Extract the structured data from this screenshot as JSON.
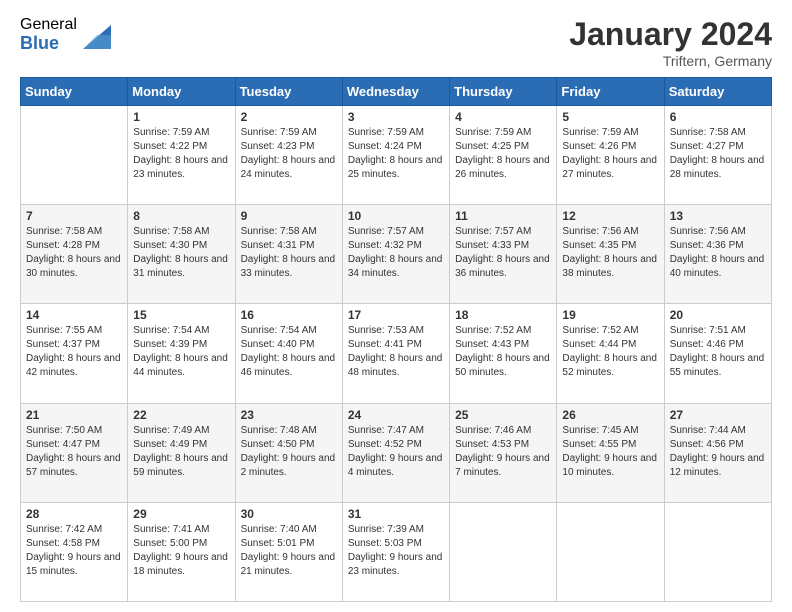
{
  "logo": {
    "general": "General",
    "blue": "Blue"
  },
  "title": "January 2024",
  "location": "Triftern, Germany",
  "days_of_week": [
    "Sunday",
    "Monday",
    "Tuesday",
    "Wednesday",
    "Thursday",
    "Friday",
    "Saturday"
  ],
  "weeks": [
    [
      {
        "num": "",
        "sunrise": "",
        "sunset": "",
        "daylight": ""
      },
      {
        "num": "1",
        "sunrise": "Sunrise: 7:59 AM",
        "sunset": "Sunset: 4:22 PM",
        "daylight": "Daylight: 8 hours and 23 minutes."
      },
      {
        "num": "2",
        "sunrise": "Sunrise: 7:59 AM",
        "sunset": "Sunset: 4:23 PM",
        "daylight": "Daylight: 8 hours and 24 minutes."
      },
      {
        "num": "3",
        "sunrise": "Sunrise: 7:59 AM",
        "sunset": "Sunset: 4:24 PM",
        "daylight": "Daylight: 8 hours and 25 minutes."
      },
      {
        "num": "4",
        "sunrise": "Sunrise: 7:59 AM",
        "sunset": "Sunset: 4:25 PM",
        "daylight": "Daylight: 8 hours and 26 minutes."
      },
      {
        "num": "5",
        "sunrise": "Sunrise: 7:59 AM",
        "sunset": "Sunset: 4:26 PM",
        "daylight": "Daylight: 8 hours and 27 minutes."
      },
      {
        "num": "6",
        "sunrise": "Sunrise: 7:58 AM",
        "sunset": "Sunset: 4:27 PM",
        "daylight": "Daylight: 8 hours and 28 minutes."
      }
    ],
    [
      {
        "num": "7",
        "sunrise": "Sunrise: 7:58 AM",
        "sunset": "Sunset: 4:28 PM",
        "daylight": "Daylight: 8 hours and 30 minutes."
      },
      {
        "num": "8",
        "sunrise": "Sunrise: 7:58 AM",
        "sunset": "Sunset: 4:30 PM",
        "daylight": "Daylight: 8 hours and 31 minutes."
      },
      {
        "num": "9",
        "sunrise": "Sunrise: 7:58 AM",
        "sunset": "Sunset: 4:31 PM",
        "daylight": "Daylight: 8 hours and 33 minutes."
      },
      {
        "num": "10",
        "sunrise": "Sunrise: 7:57 AM",
        "sunset": "Sunset: 4:32 PM",
        "daylight": "Daylight: 8 hours and 34 minutes."
      },
      {
        "num": "11",
        "sunrise": "Sunrise: 7:57 AM",
        "sunset": "Sunset: 4:33 PM",
        "daylight": "Daylight: 8 hours and 36 minutes."
      },
      {
        "num": "12",
        "sunrise": "Sunrise: 7:56 AM",
        "sunset": "Sunset: 4:35 PM",
        "daylight": "Daylight: 8 hours and 38 minutes."
      },
      {
        "num": "13",
        "sunrise": "Sunrise: 7:56 AM",
        "sunset": "Sunset: 4:36 PM",
        "daylight": "Daylight: 8 hours and 40 minutes."
      }
    ],
    [
      {
        "num": "14",
        "sunrise": "Sunrise: 7:55 AM",
        "sunset": "Sunset: 4:37 PM",
        "daylight": "Daylight: 8 hours and 42 minutes."
      },
      {
        "num": "15",
        "sunrise": "Sunrise: 7:54 AM",
        "sunset": "Sunset: 4:39 PM",
        "daylight": "Daylight: 8 hours and 44 minutes."
      },
      {
        "num": "16",
        "sunrise": "Sunrise: 7:54 AM",
        "sunset": "Sunset: 4:40 PM",
        "daylight": "Daylight: 8 hours and 46 minutes."
      },
      {
        "num": "17",
        "sunrise": "Sunrise: 7:53 AM",
        "sunset": "Sunset: 4:41 PM",
        "daylight": "Daylight: 8 hours and 48 minutes."
      },
      {
        "num": "18",
        "sunrise": "Sunrise: 7:52 AM",
        "sunset": "Sunset: 4:43 PM",
        "daylight": "Daylight: 8 hours and 50 minutes."
      },
      {
        "num": "19",
        "sunrise": "Sunrise: 7:52 AM",
        "sunset": "Sunset: 4:44 PM",
        "daylight": "Daylight: 8 hours and 52 minutes."
      },
      {
        "num": "20",
        "sunrise": "Sunrise: 7:51 AM",
        "sunset": "Sunset: 4:46 PM",
        "daylight": "Daylight: 8 hours and 55 minutes."
      }
    ],
    [
      {
        "num": "21",
        "sunrise": "Sunrise: 7:50 AM",
        "sunset": "Sunset: 4:47 PM",
        "daylight": "Daylight: 8 hours and 57 minutes."
      },
      {
        "num": "22",
        "sunrise": "Sunrise: 7:49 AM",
        "sunset": "Sunset: 4:49 PM",
        "daylight": "Daylight: 8 hours and 59 minutes."
      },
      {
        "num": "23",
        "sunrise": "Sunrise: 7:48 AM",
        "sunset": "Sunset: 4:50 PM",
        "daylight": "Daylight: 9 hours and 2 minutes."
      },
      {
        "num": "24",
        "sunrise": "Sunrise: 7:47 AM",
        "sunset": "Sunset: 4:52 PM",
        "daylight": "Daylight: 9 hours and 4 minutes."
      },
      {
        "num": "25",
        "sunrise": "Sunrise: 7:46 AM",
        "sunset": "Sunset: 4:53 PM",
        "daylight": "Daylight: 9 hours and 7 minutes."
      },
      {
        "num": "26",
        "sunrise": "Sunrise: 7:45 AM",
        "sunset": "Sunset: 4:55 PM",
        "daylight": "Daylight: 9 hours and 10 minutes."
      },
      {
        "num": "27",
        "sunrise": "Sunrise: 7:44 AM",
        "sunset": "Sunset: 4:56 PM",
        "daylight": "Daylight: 9 hours and 12 minutes."
      }
    ],
    [
      {
        "num": "28",
        "sunrise": "Sunrise: 7:42 AM",
        "sunset": "Sunset: 4:58 PM",
        "daylight": "Daylight: 9 hours and 15 minutes."
      },
      {
        "num": "29",
        "sunrise": "Sunrise: 7:41 AM",
        "sunset": "Sunset: 5:00 PM",
        "daylight": "Daylight: 9 hours and 18 minutes."
      },
      {
        "num": "30",
        "sunrise": "Sunrise: 7:40 AM",
        "sunset": "Sunset: 5:01 PM",
        "daylight": "Daylight: 9 hours and 21 minutes."
      },
      {
        "num": "31",
        "sunrise": "Sunrise: 7:39 AM",
        "sunset": "Sunset: 5:03 PM",
        "daylight": "Daylight: 9 hours and 23 minutes."
      },
      {
        "num": "",
        "sunrise": "",
        "sunset": "",
        "daylight": ""
      },
      {
        "num": "",
        "sunrise": "",
        "sunset": "",
        "daylight": ""
      },
      {
        "num": "",
        "sunrise": "",
        "sunset": "",
        "daylight": ""
      }
    ]
  ]
}
